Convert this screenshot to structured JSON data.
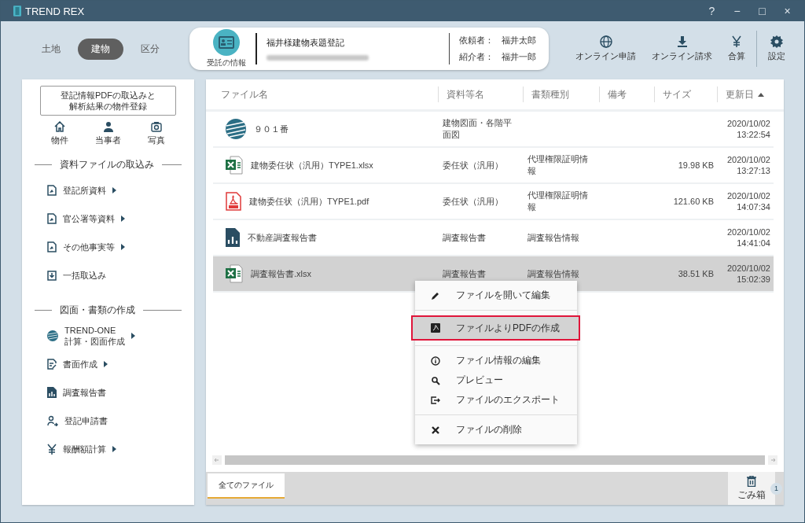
{
  "window": {
    "title": "TREND REX",
    "controls": [
      "?",
      "−",
      "□",
      "×"
    ]
  },
  "category_tabs": [
    {
      "label": "土地",
      "selected": false
    },
    {
      "label": "建物",
      "selected": true
    },
    {
      "label": "区分",
      "selected": false
    }
  ],
  "case_card": {
    "button_label": "受託の情報",
    "case_title": "福井様建物表題登記",
    "client_label": "依頼者：",
    "client": "福井太郎",
    "referrer_label": "紹介者：",
    "referrer": "福井一郎"
  },
  "toolbar": [
    {
      "kind": "globe",
      "label": "オンライン申請"
    },
    {
      "kind": "download",
      "label": "オンライン請求"
    },
    {
      "kind": "yen",
      "label": "合算"
    },
    {
      "kind": "gear",
      "label": "設定"
    }
  ],
  "sidebar": {
    "import_button": "登記情報PDFの取込みと解析結果の物件登録",
    "shortcuts": [
      {
        "kind": "home",
        "label": "物件"
      },
      {
        "kind": "person",
        "label": "当事者"
      },
      {
        "kind": "camera",
        "label": "写真"
      }
    ],
    "sections": [
      {
        "title": "資料ファイルの取込み",
        "items": [
          {
            "kind": "doc",
            "label": "登記所資料",
            "submenu": true
          },
          {
            "kind": "doc",
            "label": "官公署等資料",
            "submenu": true
          },
          {
            "kind": "doc",
            "label": "その他事実等",
            "submenu": true
          },
          {
            "kind": "clipboard",
            "label": "一括取込み",
            "submenu": false
          }
        ]
      },
      {
        "title": "図面・書類の作成",
        "items": [
          {
            "kind": "globe",
            "label": "TREND-ONE\n計算・図面作成",
            "submenu": true
          },
          {
            "kind": "pen-doc",
            "label": "書面作成",
            "submenu": true
          },
          {
            "kind": "report",
            "label": "調査報告書",
            "submenu": false
          },
          {
            "kind": "person-arrow",
            "label": "登記申請書",
            "submenu": false
          },
          {
            "kind": "yen",
            "label": "報酬額計算",
            "submenu": true
          }
        ]
      }
    ]
  },
  "table": {
    "columns": [
      {
        "label": "ファイル名",
        "sorted": false
      },
      {
        "label": "資料等名",
        "sorted": false
      },
      {
        "label": "書類種別",
        "sorted": false
      },
      {
        "label": "備考",
        "sorted": false
      },
      {
        "label": "サイズ",
        "sorted": false
      },
      {
        "label": "更新日",
        "sorted": true
      }
    ],
    "rows": [
      {
        "kind": "trendone",
        "name": "９０１番",
        "material": "建物図面・各階平面図",
        "doc_type": "",
        "size": "",
        "date": "2020/10/02",
        "time": "13:22:54",
        "selected": false
      },
      {
        "kind": "excel",
        "name": "建物委任状（汎用）TYPE1.xlsx",
        "material": "委任状（汎用）",
        "doc_type": "代理権限証明情報",
        "size": "19.98 KB",
        "date": "2020/10/02",
        "time": "13:27:13",
        "selected": false
      },
      {
        "kind": "pdf",
        "name": "建物委任状（汎用）TYPE1.pdf",
        "material": "委任状（汎用）",
        "doc_type": "代理権限証明情報",
        "size": "121.60 KB",
        "date": "2020/10/02",
        "time": "14:07:34",
        "selected": false
      },
      {
        "kind": "report",
        "name": "不動産調査報告書",
        "material": "調査報告書",
        "doc_type": "調査報告情報",
        "size": "",
        "date": "2020/10/02",
        "time": "14:41:04",
        "selected": false
      },
      {
        "kind": "excel",
        "name": "調査報告書.xlsx",
        "material": "調査報告書",
        "doc_type": "調査報告情報",
        "size": "38.51 KB",
        "date": "2020/10/02",
        "time": "15:02:39",
        "selected": true
      }
    ]
  },
  "context_menu": [
    {
      "kind": "pencil",
      "label": "ファイルを開いて編集",
      "selected": false,
      "divider_after": true
    },
    {
      "kind": "pdf",
      "label": "ファイルよりPDFの作成",
      "selected": true,
      "divider_after": true
    },
    {
      "kind": "info",
      "label": "ファイル情報の編集",
      "selected": false,
      "divider_after": false
    },
    {
      "kind": "search",
      "label": "プレビュー",
      "selected": false,
      "divider_after": false
    },
    {
      "kind": "export",
      "label": "ファイルのエクスポート",
      "selected": false,
      "divider_after": true
    },
    {
      "kind": "delete",
      "label": "ファイルの削除",
      "selected": false,
      "divider_after": false
    }
  ],
  "file_tabs": [
    {
      "label": "全てのファイル",
      "selected": true
    }
  ],
  "trash": {
    "label": "ごみ箱",
    "count": "1"
  }
}
